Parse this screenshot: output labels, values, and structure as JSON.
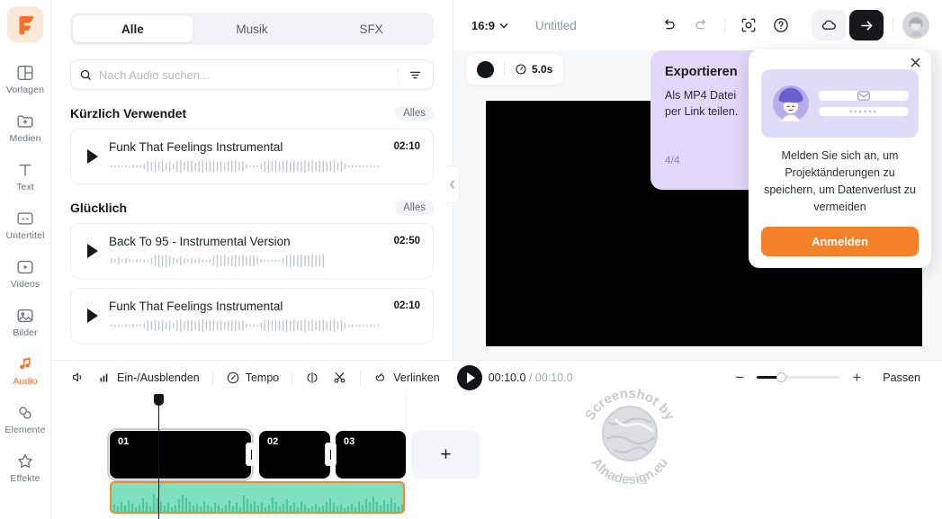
{
  "rail": {
    "logo": "F",
    "items": [
      {
        "label": "Vorlagen",
        "icon": "templates-icon",
        "active": false
      },
      {
        "label": "Medien",
        "icon": "media-icon",
        "active": false
      },
      {
        "label": "Text",
        "icon": "text-icon",
        "active": false
      },
      {
        "label": "Untertitel",
        "icon": "subtitle-icon",
        "active": false
      },
      {
        "label": "Videos",
        "icon": "video-icon",
        "active": false
      },
      {
        "label": "Bilder",
        "icon": "image-icon",
        "active": false
      },
      {
        "label": "Audio",
        "icon": "audio-icon",
        "active": true
      },
      {
        "label": "Elemente",
        "icon": "elements-icon",
        "active": false
      },
      {
        "label": "Effekte",
        "icon": "effects-icon",
        "active": false
      }
    ]
  },
  "panel": {
    "tabs": [
      {
        "label": "Alle",
        "active": true
      },
      {
        "label": "Musik",
        "active": false
      },
      {
        "label": "SFX",
        "active": false
      }
    ],
    "search": {
      "placeholder": "Nach Audio suchen...",
      "value": "",
      "icon": "search-icon",
      "filter_icon": "filter-icon"
    },
    "sections": [
      {
        "title": "Kürzlich Verwendet",
        "all_label": "Alles",
        "tracks": [
          {
            "name": "Funk That Feelings Instrumental",
            "duration": "02:10"
          }
        ]
      },
      {
        "title": "Glücklich",
        "all_label": "Alles",
        "tracks": [
          {
            "name": "Back To 95 - Instrumental Version",
            "duration": "02:50"
          },
          {
            "name": "Funk That Feelings Instrumental",
            "duration": "02:10"
          }
        ]
      }
    ],
    "collapse_icon": "chevron-left-icon"
  },
  "topbar": {
    "ratio": "16:9",
    "ratio_caret": "chevron-down-icon",
    "title": "Untitled",
    "undo_icon": "undo-icon",
    "redo_icon": "redo-icon",
    "focus_icon": "focus-frame-icon",
    "help_icon": "question-circle-icon",
    "cloud_icon": "cloud-icon",
    "export_icon": "arrow-right-icon",
    "avatar": "user-avatar"
  },
  "stage": {
    "color_swatch": "#111418",
    "duration": "5.0s",
    "clock_icon": "clock-icon"
  },
  "coachtip": {
    "title": "Exportieren",
    "body": "Als MP4 Datei\nper Link teilen.",
    "step": "4/4"
  },
  "loginpop": {
    "close_icon": "close-icon",
    "email_icon": "mail-icon",
    "password_dots": "••••••",
    "message": "Melden Sie sich an, um Projektänderungen zu speichern, um Datenverlust zu vermeiden",
    "cta": "Anmelden",
    "cta_color": "#f58228"
  },
  "bottombar": {
    "volume_icon": "volume-icon",
    "fade_icon": "fade-bars-icon",
    "fade_label": "Ein-/Ausblenden",
    "tempo_icon": "speed-gauge-icon",
    "tempo_label": "Tempo",
    "split_icon": "split-icon",
    "cut_icon": "scissors-icon",
    "link_icon": "link-icon",
    "link_label": "Verlinken",
    "play_icon": "play-icon",
    "time_current": "00:10.0",
    "time_separator": " / ",
    "time_total": "00:10.0",
    "zoom_out": "−",
    "zoom_in": "+",
    "fit_label": "Passen"
  },
  "timeline": {
    "clips": [
      {
        "label": "01",
        "selected": true
      },
      {
        "label": "02",
        "selected": false
      },
      {
        "label": "03",
        "selected": false
      }
    ],
    "add_label": "+",
    "audio_track_color": "#7fe0c0",
    "audio_border_color": "#f0882e"
  },
  "watermark": {
    "top_text": "Screenshot by",
    "bottom_text": "Alnadesign.eu"
  }
}
